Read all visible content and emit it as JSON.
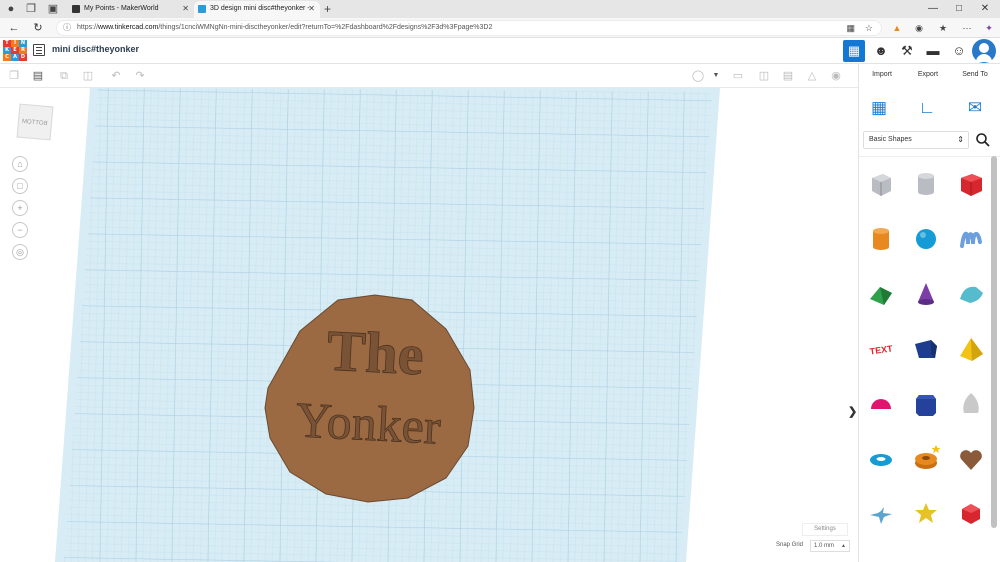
{
  "browser": {
    "tabs": [
      {
        "title": "My Points - MakerWorld",
        "active": false
      },
      {
        "title": "3D design mini disc#theyonker -",
        "active": true
      }
    ],
    "url": {
      "prefix": "https://",
      "domain": "www.tinkercad.com",
      "path": "/things/1cnciWMNgNn-mini-disctheyonker/edit?returnTo=%2Fdashboard%2Fdesigns%2F3d%3Fpage%3D2"
    }
  },
  "tinkercad": {
    "logo_letters": [
      "T",
      "I",
      "N",
      "K",
      "E",
      "R",
      "C",
      "A",
      "D"
    ],
    "logo_colors": [
      "#e8392f",
      "#f47a20",
      "#2e9bd6",
      "#2e9bd6",
      "#e8392f",
      "#f47a20",
      "#f47a20",
      "#2e9bd6",
      "#e8392f"
    ],
    "design_title": "mini disc#theyonker"
  },
  "panel": {
    "tabs": [
      "Import",
      "Export",
      "Send To"
    ],
    "shape_category": "Basic Shapes"
  },
  "canvas": {
    "viewcube_label": "BOTTOM",
    "disc_text_line1": "The",
    "disc_text_line2": "Yonker",
    "settings_label": "Settings",
    "snap_grid_label": "Snap Grid",
    "snap_grid_value": "1.0 mm"
  },
  "colors": {
    "accent": "#1477d1",
    "disc_fill": "#9b6a43",
    "grid_bg": "#cfe7f2"
  },
  "shapes": [
    {
      "name": "box-hole",
      "color": "#b9bcc2"
    },
    {
      "name": "cylinder-hole",
      "color": "#b9bcc2"
    },
    {
      "name": "box",
      "color": "#d7262d"
    },
    {
      "name": "cylinder",
      "color": "#e8891f"
    },
    {
      "name": "sphere",
      "color": "#159bd6"
    },
    {
      "name": "scribble",
      "color": "#6c9fdc"
    },
    {
      "name": "roof",
      "color": "#2ea14a"
    },
    {
      "name": "cone",
      "color": "#7b3fa7"
    },
    {
      "name": "round-roof",
      "color": "#56bccd"
    },
    {
      "name": "text",
      "color": "#d7262d"
    },
    {
      "name": "wedge",
      "color": "#1f3d8f"
    },
    {
      "name": "pyramid",
      "color": "#f2c316"
    },
    {
      "name": "half-sphere",
      "color": "#e0156f"
    },
    {
      "name": "polygon",
      "color": "#24419b"
    },
    {
      "name": "paraboloid",
      "color": "#c9c9c9"
    },
    {
      "name": "torus",
      "color": "#169bd3"
    },
    {
      "name": "tube",
      "color": "#e8891f"
    },
    {
      "name": "heart",
      "color": "#8a5a3a"
    },
    {
      "name": "star",
      "color": "#5ca3cf"
    },
    {
      "name": "star-gold",
      "color": "#e6c229"
    },
    {
      "name": "icosahedron",
      "color": "#d7262d"
    }
  ]
}
